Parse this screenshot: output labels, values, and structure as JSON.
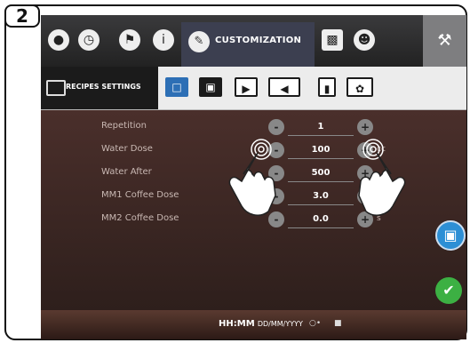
{
  "step_label": "2",
  "topbar": {
    "icons": [
      "water-drop-icon",
      "clock-icon",
      "flag-icon",
      "info-icon"
    ],
    "active_tab_label": "CUSTOMIZATION",
    "right_icons": [
      "display-icon",
      "user-icon",
      "wrench-icon"
    ]
  },
  "subbar": {
    "active_label": "RECIPES SETTINGS",
    "icons": [
      "recipe-book-icon",
      "screen-image-icon",
      "screen-video-icon",
      "speaker-icon",
      "cup-icon",
      "palette-icon"
    ]
  },
  "rows": [
    {
      "label": "Repetition",
      "value": "1",
      "unit": ""
    },
    {
      "label": "Water Dose",
      "value": "100",
      "unit": "cc"
    },
    {
      "label": "Water After",
      "value": "500",
      "unit": ""
    },
    {
      "label": "MM1 Coffee Dose",
      "value": "3.0",
      "unit": ""
    },
    {
      "label": "MM2 Coffee Dose",
      "value": "0.0",
      "unit": "s"
    }
  ],
  "bottombar": {
    "time": "HH:MM",
    "date": "DD/MM/YYYY"
  },
  "colors": {
    "confirm": "#3cb043",
    "preview": "#2d8fd5"
  }
}
